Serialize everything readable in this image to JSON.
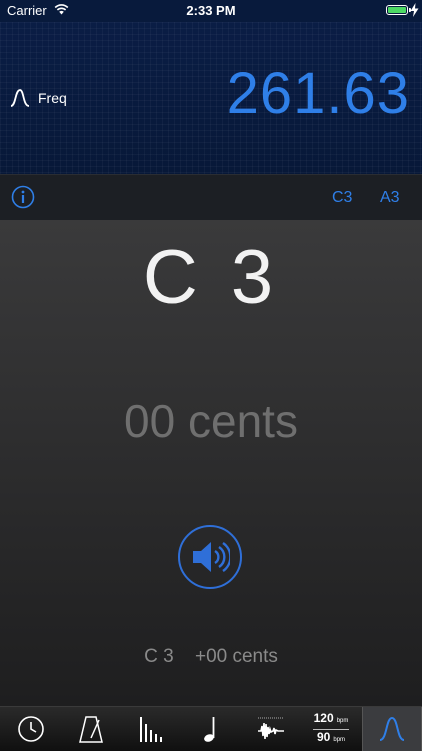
{
  "status_bar": {
    "carrier": "Carrier",
    "time": "2:33 PM",
    "battery_level": 1.0,
    "battery_color": "#4cd964"
  },
  "freq_panel": {
    "label": "Freq",
    "value": "261.63",
    "icon": "sine-wave-icon",
    "value_color": "#2f7fe8"
  },
  "info_bar": {
    "info_icon": "info-icon",
    "notes": [
      "C3",
      "A3"
    ]
  },
  "tuner": {
    "note": "C 3",
    "cents": "00 cents",
    "summary_note": "C 3",
    "summary_cents": "+00 cents",
    "play_icon": "speaker-icon"
  },
  "tab_bar": {
    "tabs": [
      {
        "icon": "clock-icon"
      },
      {
        "icon": "metronome-icon"
      },
      {
        "icon": "beat-bars-icon"
      },
      {
        "icon": "music-note-icon"
      },
      {
        "icon": "waveform-icon"
      },
      {
        "icon": "tempo-icon",
        "top_bpm": "120",
        "bottom_bpm": "90",
        "unit": "bpm"
      },
      {
        "icon": "sine-wave-icon",
        "active": true
      }
    ],
    "accent": "#2f7fe8"
  }
}
